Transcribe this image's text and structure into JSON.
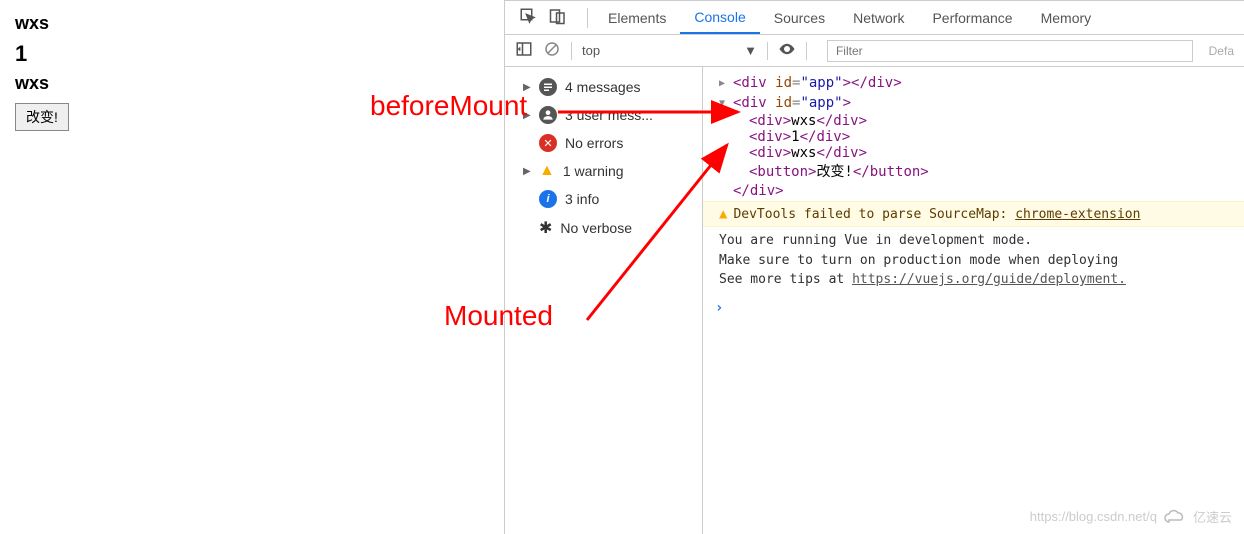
{
  "page": {
    "line1": "wxs",
    "line2": "1",
    "line3": "wxs",
    "button": "改变!"
  },
  "annotations": {
    "beforeMount": "beforeMount",
    "mounted": "Mounted"
  },
  "tabs": {
    "elements": "Elements",
    "console": "Console",
    "sources": "Sources",
    "network": "Network",
    "performance": "Performance",
    "memory": "Memory"
  },
  "toolbar": {
    "context": "top",
    "filter_placeholder": "Filter",
    "levels": "Defa"
  },
  "sidebar": {
    "items": [
      {
        "label": "4 messages"
      },
      {
        "label": "3 user mess..."
      },
      {
        "label": "No errors"
      },
      {
        "label": "1 warning"
      },
      {
        "label": "3 info"
      },
      {
        "label": "No verbose"
      }
    ]
  },
  "console_output": {
    "line1": {
      "tag_open": "<div",
      "attr": "id",
      "val": "\"app\"",
      "tag_mid": ">",
      "tag_close": "</div>"
    },
    "line2": {
      "tag_open": "<div",
      "attr": "id",
      "val": "\"app\"",
      "tag_mid": ">"
    },
    "child1": {
      "open": "<div>",
      "text": "wxs",
      "close": "</div>"
    },
    "child2": {
      "open": "<div>",
      "text": "1",
      "close": "</div>"
    },
    "child3": {
      "open": "<div>",
      "text": "wxs",
      "close": "</div>"
    },
    "child4": {
      "open": "<button>",
      "text": "改变!",
      "close": "</button>"
    },
    "line_close": {
      "close": "</div>"
    },
    "warn": {
      "pre": "DevTools failed to parse SourceMap: ",
      "link": "chrome-extension"
    },
    "msg1": "You are running Vue in development mode.",
    "msg2": "Make sure to turn on production mode when deploying ",
    "msg3_pre": "See more tips at ",
    "msg3_link": "https://vuejs.org/guide/deployment."
  },
  "watermark": {
    "blog": "https://blog.csdn.net/q",
    "brand": "亿速云"
  }
}
